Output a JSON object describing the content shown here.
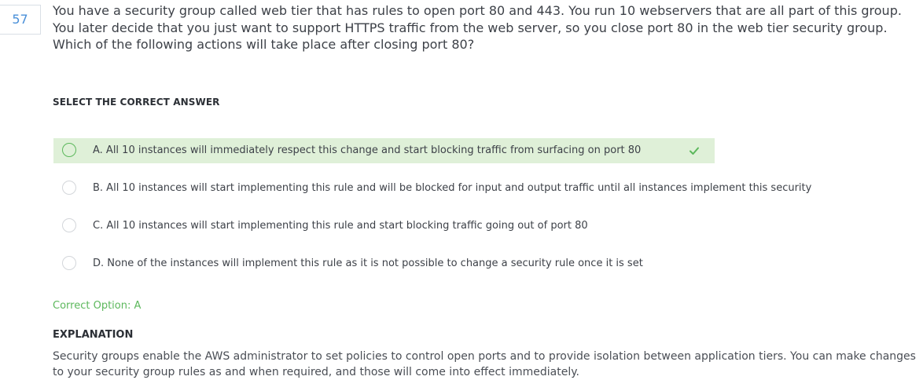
{
  "question": {
    "number": "57",
    "text": "You have a security group called web tier that has rules to open port 80 and 443. You run 10 webservers that are all part of this group. You later decide that you just want to support HTTPS traffic from the web server, so you close port 80 in the web tier security group. Which of the following actions will take place after closing port 80?"
  },
  "select_heading": "SELECT THE CORRECT ANSWER",
  "options": [
    {
      "label": "A. All 10 instances will immediately respect this change and start blocking traffic from surfacing on port 80",
      "correct": true
    },
    {
      "label": "B. All 10 instances will start implementing this rule and will be blocked for input and output traffic until all instances implement this security",
      "correct": false
    },
    {
      "label": "C. All 10 instances will start implementing this rule and start blocking traffic going out of port 80",
      "correct": false
    },
    {
      "label": "D. None of the instances will implement this rule as it is not possible to change a security rule once it is set",
      "correct": false
    }
  ],
  "correct_option_text": "Correct Option: A",
  "explanation": {
    "heading": "EXPLANATION",
    "text": "Security groups enable the AWS administrator to set policies to control open ports and to provide isolation between application tiers. You can make changes to your security group rules as and when required, and those will come into effect immediately."
  },
  "colors": {
    "accent_blue": "#4a90d9",
    "correct_green": "#5cb85c",
    "correct_bg": "#dff0d8"
  }
}
